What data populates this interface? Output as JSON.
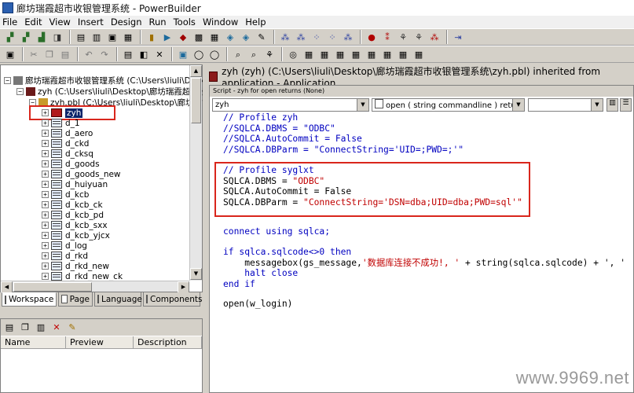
{
  "window": {
    "title": "廊坊瑞霞超市收银管理系统 - PowerBuilder"
  },
  "menu": [
    "File",
    "Edit",
    "View",
    "Insert",
    "Design",
    "Run",
    "Tools",
    "Window",
    "Help"
  ],
  "tree": {
    "workspace": "廊坊瑞霞超市收银管理系统 (C:\\Users\\liuli\\Deskt",
    "target": "zyh (C:\\Users\\liuli\\Desktop\\廊坊瑞霞超市收银管理系统",
    "library": "zyh.pbl (C:\\Users\\liuli\\Desktop\\廊坊瑞霞超",
    "items": [
      "zyh",
      "d_1",
      "d_aero",
      "d_ckd",
      "d_cksq",
      "d_goods",
      "d_goods_new",
      "d_huiyuan",
      "d_kcb",
      "d_kcb_ck",
      "d_kcb_pd",
      "d_kcb_sxx",
      "d_kcb_yjcx",
      "d_log",
      "d_rkd",
      "d_rkd_new",
      "d_rkd_new_ck"
    ]
  },
  "tabs": [
    "Workspace",
    "Page",
    "Language",
    "Components"
  ],
  "list": {
    "columns": [
      "Name",
      "Preview",
      "Description"
    ]
  },
  "painter": {
    "title": "zyh (zyh) (C:\\Users\\liuli\\Desktop\\廊坊瑞霞超市收银管理系统\\zyh.pbl) inherited from application - Application",
    "script_header": "Script - zyh for open returns (None)",
    "object_combo": "zyh",
    "event_combo": "open ( string commandline ) returns (none)",
    "third_combo": ""
  },
  "code": {
    "block1": [
      "// Profile zyh",
      "//SQLCA.DBMS = \"ODBC\"",
      "//SQLCA.AutoCommit = False",
      "//SQLCA.DBParm = \"ConnectString='UID=;PWD=;'\""
    ],
    "block2": {
      "comment": "// Profile syglxt",
      "dbms_lhs": "SQLCA.DBMS = ",
      "dbms_rhs": "\"ODBC\"",
      "autocommit": "SQLCA.AutoCommit = False",
      "dbparm_lhs": "SQLCA.DBParm = ",
      "dbparm_rhs": "\"ConnectString='DSN=dba;UID=dba;PWD=sql'\""
    },
    "connect": "connect using sqlca;",
    "if_line": "if sqlca.sqlcode<>0 then",
    "msg_a": "    messagebox(gs_message,",
    "msg_b": "'数据库连接不成功!, '",
    "msg_c": " + string(sqlca.sqlcode) + ', '",
    "halt": "    halt close",
    "endif": "end if",
    "open": "open(w_login)"
  },
  "watermark": "www.9969.net"
}
